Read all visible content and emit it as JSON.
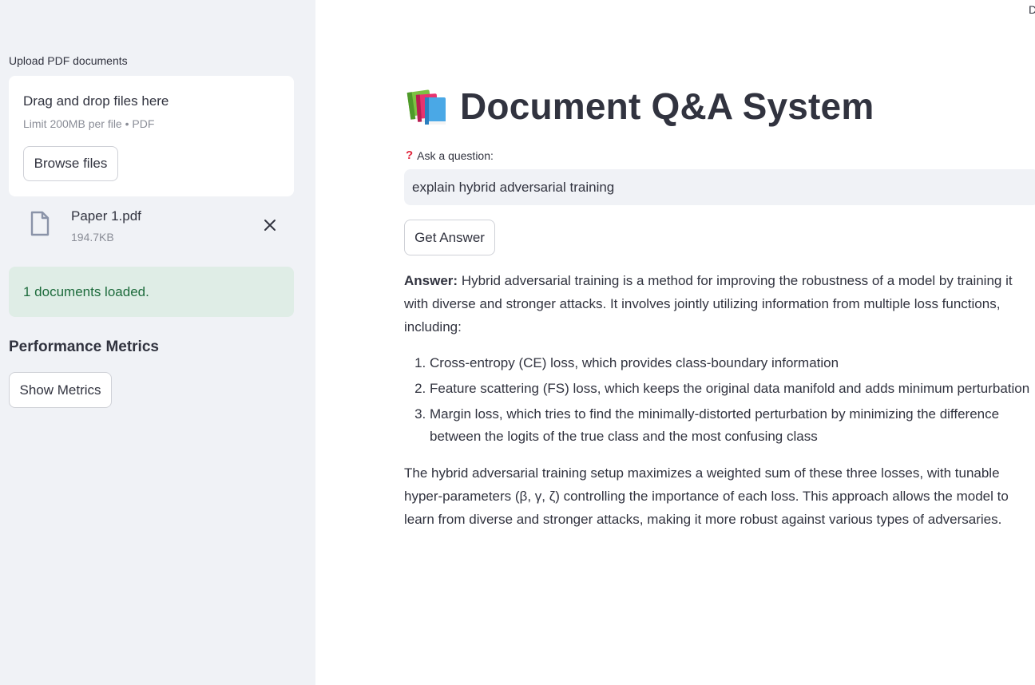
{
  "sidebar": {
    "upload_label": "Upload PDF documents",
    "dropzone": {
      "title": "Drag and drop files here",
      "subtitle": "Limit 200MB per file • PDF",
      "browse_label": "Browse files"
    },
    "file": {
      "name": "Paper 1.pdf",
      "size": "194.7KB",
      "icon": "file-icon",
      "remove_icon": "close-icon"
    },
    "status": "1 documents loaded.",
    "metrics_heading": "Performance Metrics",
    "metrics_button": "Show Metrics"
  },
  "main": {
    "corner_text": "D",
    "title_icon": "books-icon",
    "title": "Document Q&A System",
    "question_icon": "question-mark-icon",
    "question_label": "Ask a question:",
    "question_value": "explain hybrid adversarial training",
    "answer_button": "Get Answer",
    "answer": {
      "label": "Answer:",
      "intro": "Hybrid adversarial training is a method for improving the robustness of a model by training it with diverse and stronger attacks. It involves jointly utilizing information from multiple loss functions, including:",
      "items": [
        "Cross-entropy (CE) loss, which provides class-boundary information",
        "Feature scattering (FS) loss, which keeps the original data manifold and adds minimum perturbation",
        "Margin loss, which tries to find the minimally-distorted perturbation by minimizing the difference between the logits of the true class and the most confusing class"
      ],
      "conclusion": "The hybrid adversarial training setup maximizes a weighted sum of these three losses, with tunable hyper-parameters (β, γ, ζ) controlling the importance of each loss. This approach allows the model to learn from diverse and stronger attacks, making it more robust against various types of adversaries."
    }
  },
  "colors": {
    "sidebar_bg": "#f0f2f6",
    "success_bg": "#dfede6",
    "success_text": "#1d6b3c",
    "text": "#31333f",
    "muted": "#8a8d97",
    "accent_red": "#e0283e"
  }
}
